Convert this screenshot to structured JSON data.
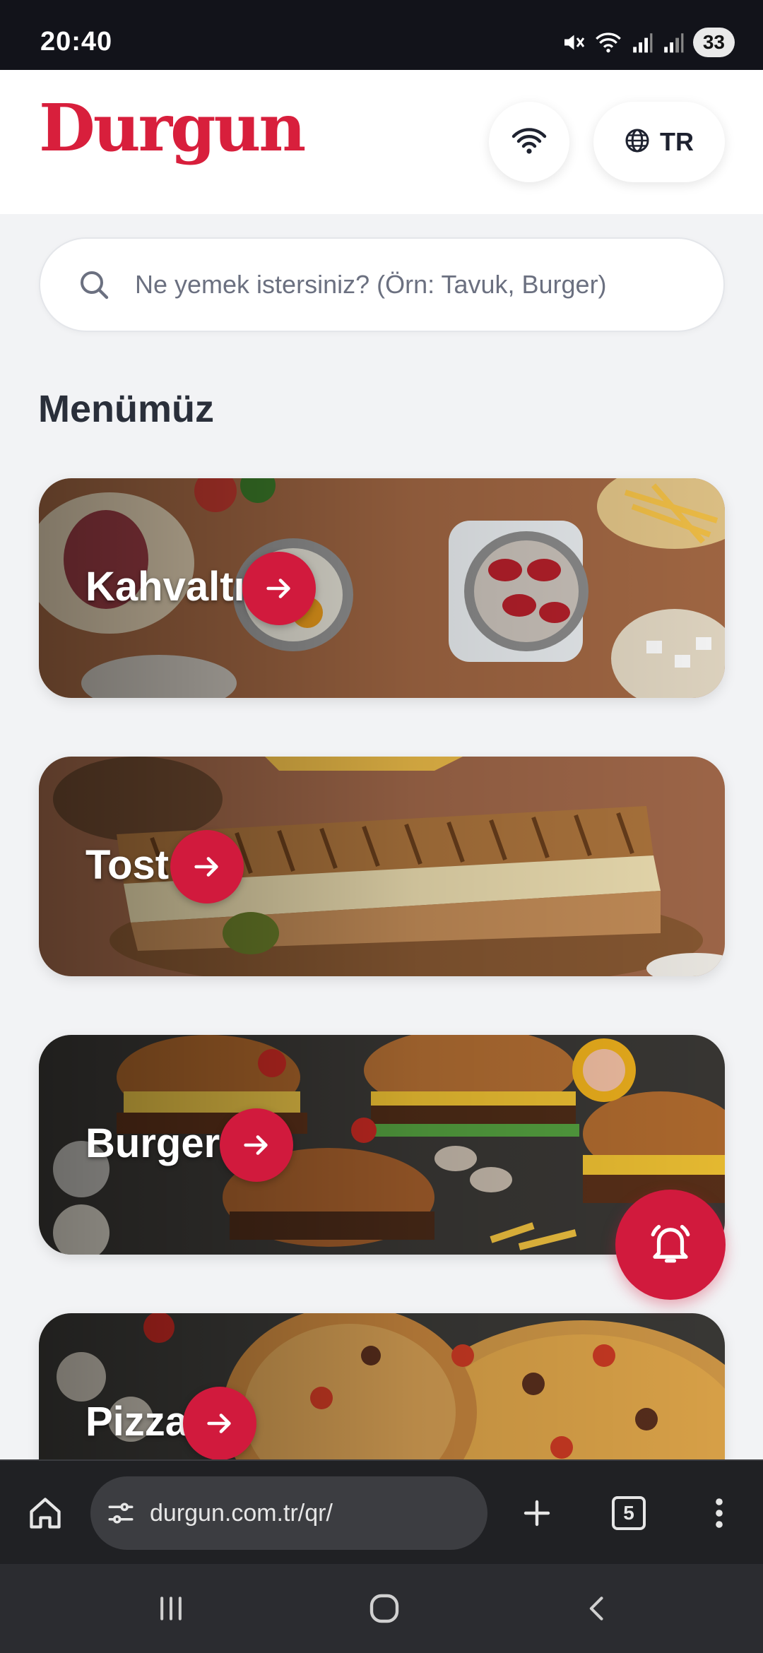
{
  "status_bar": {
    "time": "20:40",
    "battery": "33"
  },
  "header": {
    "logo": "Durgun",
    "wifi_icon": "wifi-icon",
    "language": {
      "icon": "globe-icon",
      "label": "TR"
    }
  },
  "search": {
    "placeholder": "Ne yemek istersiniz? (Örn: Tavuk, Burger)"
  },
  "section_title": "Menümüz",
  "categories": [
    {
      "label": "Kahvaltı"
    },
    {
      "label": "Tost"
    },
    {
      "label": "Burger"
    },
    {
      "label": "Pizza"
    }
  ],
  "fab": {
    "icon": "bell-icon"
  },
  "browser": {
    "url": "durgun.com.tr/qr/",
    "tab_count": "5"
  },
  "colors": {
    "brand": "#d11a3d",
    "logo": "#d81f3c"
  }
}
